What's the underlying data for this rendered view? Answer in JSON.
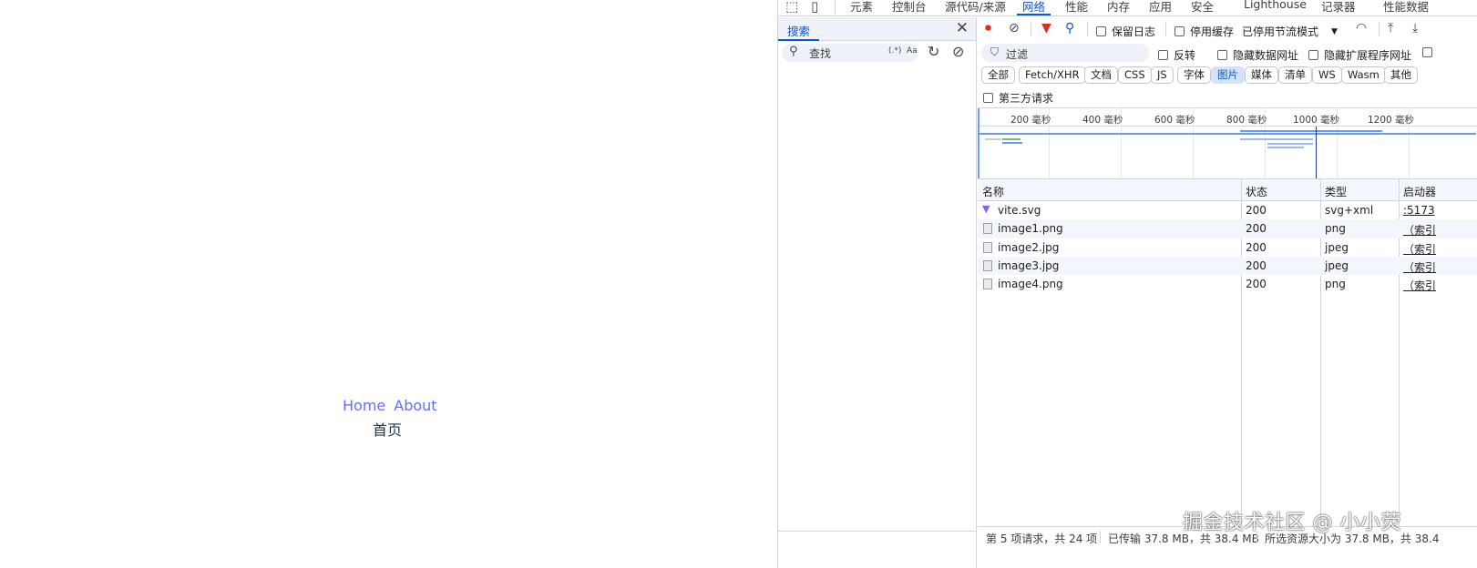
{
  "app": {
    "nav": [
      "Home",
      "About"
    ],
    "page_text": "首页"
  },
  "devtools": {
    "tabs": [
      "元素",
      "控制台",
      "源代码/来源",
      "网络",
      "性能",
      "内存",
      "应用",
      "安全",
      "Lighthouse",
      "记录器",
      "性能数据"
    ],
    "active_tab": "网络",
    "search_pane": {
      "tab_label": "搜索",
      "placeholder": "查找",
      "regex_label": "(.*)",
      "case_label": "Aa"
    },
    "toolbar": {
      "preserve_log": "保留日志",
      "disable_cache": "停用缓存",
      "throttling": "已停用节流模式"
    },
    "filter": {
      "placeholder": "过滤",
      "invert": "反转",
      "hide_data_urls": "隐藏数据网址",
      "hide_extension_urls": "隐藏扩展程序网址"
    },
    "type_chips": [
      "全部",
      "Fetch/XHR",
      "文档",
      "CSS",
      "JS",
      "字体",
      "图片",
      "媒体",
      "清单",
      "WS",
      "Wasm",
      "其他"
    ],
    "active_chip": "图片",
    "third_party": "第三方请求",
    "timeline_ticks": [
      "200 毫秒",
      "400 毫秒",
      "600 毫秒",
      "800 毫秒",
      "1000 毫秒",
      "1200 毫秒"
    ],
    "columns": [
      "名称",
      "状态",
      "类型",
      "启动器"
    ],
    "rows": [
      {
        "name": "vite.svg",
        "status": "200",
        "type": "svg+xml",
        "initiator": ":5173"
      },
      {
        "name": "image1.png",
        "status": "200",
        "type": "png",
        "initiator": "（索引"
      },
      {
        "name": "image2.jpg",
        "status": "200",
        "type": "jpeg",
        "initiator": "（索引"
      },
      {
        "name": "image3.jpg",
        "status": "200",
        "type": "jpeg",
        "initiator": "（索引"
      },
      {
        "name": "image4.png",
        "status": "200",
        "type": "png",
        "initiator": "（索引"
      }
    ],
    "status_bar": {
      "requests": "第 5 项请求，共 24 项",
      "transferred": "已传输 37.8 MB，共 38.4 MB",
      "resources": "所选资源大小为 37.8 MB，共 38.4"
    }
  },
  "watermark": "掘金技术社区 @ 小小荧",
  "colors": {
    "accent": "#0b57d0",
    "link": "#646cff",
    "record": "#d93025",
    "filter_active": "#d93025"
  }
}
